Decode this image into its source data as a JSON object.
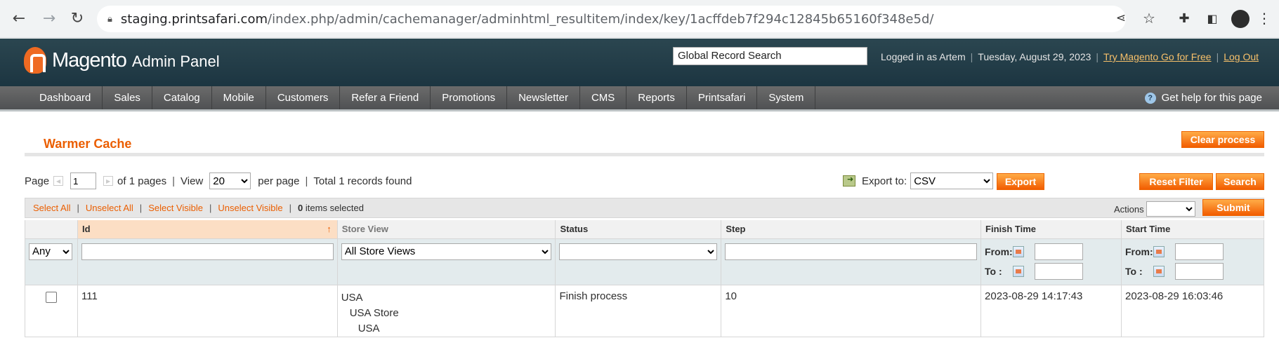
{
  "browser": {
    "url_host": "staging.printsafari.com",
    "url_path": "/index.php/admin/cachemanager/adminhtml_resultitem/index/key/1acffdeb7f294c12845b65160f348e5d/"
  },
  "header": {
    "logo_name": "Magento",
    "logo_panel": "Admin Panel",
    "global_search": "Global Record Search",
    "logged_in": "Logged in as Artem",
    "date": "Tuesday, August 29, 2023",
    "try_link": "Try Magento Go for Free",
    "logout": "Log Out"
  },
  "nav": {
    "items": [
      "Dashboard",
      "Sales",
      "Catalog",
      "Mobile",
      "Customers",
      "Refer a Friend",
      "Promotions",
      "Newsletter",
      "CMS",
      "Reports",
      "Printsafari",
      "System"
    ],
    "help": "Get help for this page"
  },
  "page": {
    "title": "Warmer Cache",
    "clear_process": "Clear process"
  },
  "pager": {
    "page_label": "Page",
    "page_value": "1",
    "of_pages": "of 1 pages",
    "view_label": "View",
    "per_page_value": "20",
    "per_page": "per page",
    "total": "Total 1 records found"
  },
  "export": {
    "label": "Export to:",
    "format": "CSV",
    "button": "Export"
  },
  "grid_buttons": {
    "reset": "Reset Filter",
    "search": "Search"
  },
  "massaction": {
    "select_all": "Select All",
    "unselect_all": "Unselect All",
    "select_visible": "Select Visible",
    "unselect_visible": "Unselect Visible",
    "count": "0",
    "items_selected": "items selected",
    "actions_label": "Actions",
    "submit": "Submit"
  },
  "grid": {
    "columns": [
      "Id",
      "Store View",
      "Status",
      "Step",
      "Finish Time",
      "Start Time"
    ],
    "filters": {
      "massaction_any": "Any",
      "store_view": "All Store Views",
      "from": "From:",
      "to": "To :"
    },
    "rows": [
      {
        "id": "111",
        "store_view": [
          "USA",
          "USA Store",
          "USA"
        ],
        "status": "Finish process",
        "step": "10",
        "finish_time": "2023-08-29 14:17:43",
        "start_time": "2023-08-29 16:03:46"
      }
    ]
  }
}
